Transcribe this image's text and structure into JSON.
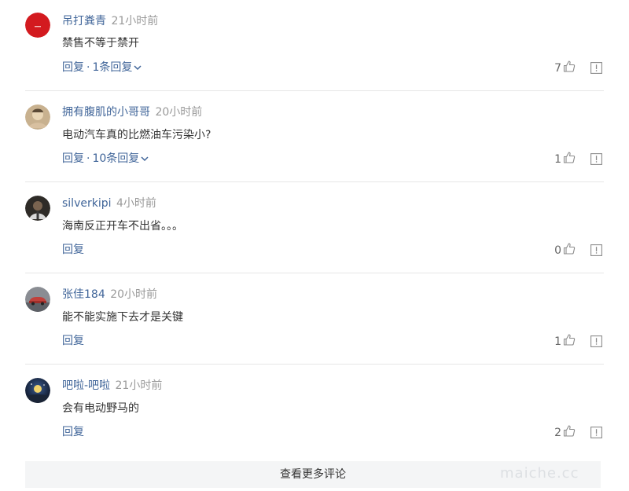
{
  "comments": [
    {
      "author": "吊打粪青",
      "time": "21小时前",
      "text": "禁售不等于禁开",
      "reply_label": "回复",
      "separator": "·",
      "replies_label": "1条回复",
      "likes": "7",
      "avatar_icon": "red-circle-avatar"
    },
    {
      "author": "拥有腹肌的小哥哥",
      "time": "20小时前",
      "text": "电动汽车真的比燃油车污染小?",
      "reply_label": "回复",
      "separator": "·",
      "replies_label": "10条回复",
      "likes": "1",
      "avatar_icon": "photo-avatar"
    },
    {
      "author": "silverkipi",
      "time": "4小时前",
      "text": "海南反正开车不出省。。。",
      "reply_label": "回复",
      "likes": "0",
      "avatar_icon": "photo-avatar"
    },
    {
      "author": "张佳184",
      "time": "20小时前",
      "text": "能不能实施下去才是关键",
      "reply_label": "回复",
      "likes": "1",
      "avatar_icon": "car-avatar"
    },
    {
      "author": "吧啦-吧啦",
      "time": "21小时前",
      "text": "会有电动野马的",
      "reply_label": "回复",
      "likes": "2",
      "avatar_icon": "night-sky-avatar"
    }
  ],
  "more_comments_label": "查看更多评论",
  "watermark": "maiche.cc",
  "colors": {
    "link": "#406599",
    "time": "#999999",
    "text": "#333333",
    "divider": "#e7e7e7",
    "more_bar_bg": "#f4f5f6"
  }
}
